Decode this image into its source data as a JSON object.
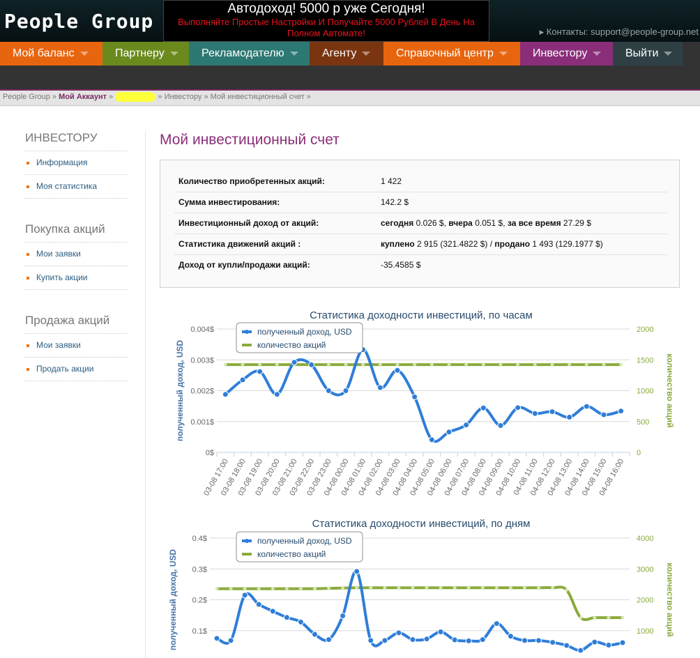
{
  "header": {
    "logo": "People Group",
    "promo_title": "Автодоход! 5000 р уже Сегодня!",
    "promo_text": "Выполняйте Простые Настройки И Получайте 5000 Рублей В День На Полном Автомате!",
    "contacts": "▸ Контакты: support@people-group.net"
  },
  "nav": [
    {
      "label": "Мой баланс",
      "color": "#e8650f"
    },
    {
      "label": "Партнеру",
      "color": "#6b8a1d"
    },
    {
      "label": "Рекламодателю",
      "color": "#2c7872"
    },
    {
      "label": "Агенту",
      "color": "#7a3510"
    },
    {
      "label": "Справочный центр",
      "color": "#e8650f"
    },
    {
      "label": "Инвестору",
      "color": "#8b2e79"
    },
    {
      "label": "Выйти",
      "color": "#2f4045"
    }
  ],
  "breadcrumb": {
    "home": "People Group",
    "sep": "»",
    "account": "Мой Аккаунт",
    "investor": "Инвестору",
    "current": "Мой инвестиционный счет"
  },
  "sidebar": {
    "sections": [
      {
        "title": "ИНВЕСТОРУ",
        "items": [
          "Информация",
          "Моя статистика"
        ]
      },
      {
        "title": "Покупка акций",
        "items": [
          "Мои заявки",
          "Купить акции"
        ]
      },
      {
        "title": "Продажа акций",
        "items": [
          "Мои заявки",
          "Продать акции"
        ]
      }
    ]
  },
  "main": {
    "title": "Мой инвестиционный счет",
    "rows": [
      {
        "key": "Количество приобретенных акций:",
        "value": "1 422"
      },
      {
        "key": "Сумма инвестирования:",
        "value": "142.2 $"
      },
      {
        "key": "Инвестиционный доход от акций:",
        "parts": [
          [
            "сегодня",
            " 0.026 $, "
          ],
          [
            "вчера",
            " 0.051 $, "
          ],
          [
            "за все время",
            " 27.29 $"
          ]
        ]
      },
      {
        "key": "Статистика движений акций :",
        "parts": [
          [
            "куплено",
            " 2 915 (321.4822 $) / "
          ],
          [
            "продано",
            " 1 493 (129.1977 $)"
          ]
        ]
      },
      {
        "key": "Доход от купли/продажи акций:",
        "value": "-35.4585 $"
      }
    ]
  },
  "chart_data": [
    {
      "type": "line",
      "title": "Статистика доходности инвестиций, по часам",
      "ylabel": "полученный доход, USD",
      "y2label": "количество акций",
      "legend_position": "top-left",
      "grid": true,
      "categories": [
        "03-08 17:00",
        "03-08 18:00",
        "03-08 19:00",
        "03-08 20:00",
        "03-08 21:00",
        "03-08 22:00",
        "03-08 23:00",
        "04-08 00:00",
        "04-08 01:00",
        "04-08 02:00",
        "04-08 03:00",
        "04-08 04:00",
        "04-08 05:00",
        "04-08 06:00",
        "04-08 07:00",
        "04-08 08:00",
        "04-08 09:00",
        "04-08 10:00",
        "04-08 11:00",
        "04-08 12:00",
        "04-08 13:00",
        "04-08 14:00",
        "04-08 15:00",
        "04-08 16:00"
      ],
      "ylim": [
        0,
        0.004
      ],
      "yticks": [
        "0$",
        "0.001$",
        "0.002$",
        "0.003$",
        "0.004$"
      ],
      "y2lim": [
        0,
        2000
      ],
      "y2ticks": [
        "0",
        "500",
        "1000",
        "1500",
        "2000"
      ],
      "series": [
        {
          "name": "полученный доход, USD",
          "axis": "left",
          "color": "#2f7ed8",
          "values": [
            0.00188,
            0.00235,
            0.00262,
            0.00188,
            0.00292,
            0.00284,
            0.002,
            0.002,
            0.00333,
            0.0021,
            0.00266,
            0.0018,
            0.00041,
            0.00066,
            0.00089,
            0.00144,
            0.00087,
            0.00145,
            0.00126,
            0.00132,
            0.00114,
            0.00149,
            0.00122,
            0.00134
          ]
        },
        {
          "name": "количество акций",
          "axis": "right",
          "color": "#8bab3c",
          "values": [
            1422,
            1422,
            1422,
            1422,
            1422,
            1422,
            1422,
            1422,
            1422,
            1422,
            1422,
            1422,
            1422,
            1422,
            1422,
            1422,
            1422,
            1422,
            1422,
            1422,
            1422,
            1422,
            1422,
            1422
          ]
        }
      ]
    },
    {
      "type": "line",
      "title": "Статистика доходности инвестиций, по дням",
      "ylabel": "полученный доход, USD",
      "y2label": "количество акций",
      "legend_position": "top-left",
      "grid": true,
      "ylim": [
        0,
        0.4
      ],
      "yticks": [
        "0.1$",
        "0.2$",
        "0.3$",
        "0.4$"
      ],
      "y2lim": [
        0,
        4000
      ],
      "y2ticks": [
        "1000",
        "2000",
        "3000",
        "4000"
      ],
      "series": [
        {
          "name": "полученный доход, USD",
          "axis": "left",
          "color": "#2f7ed8",
          "values": [
            0.075,
            0.068,
            0.215,
            0.185,
            0.163,
            0.143,
            0.128,
            0.088,
            0.071,
            0.148,
            0.292,
            0.068,
            0.068,
            0.093,
            0.071,
            0.073,
            0.096,
            0.07,
            0.067,
            0.071,
            0.123,
            0.082,
            0.068,
            0.068,
            0.062,
            0.052,
            0.036,
            0.063,
            0.053,
            0.061
          ]
        },
        {
          "name": "количество акций",
          "axis": "right",
          "color": "#8bab3c",
          "values": [
            2360,
            2360,
            2360,
            2360,
            2360,
            2360,
            2360,
            2360,
            2370,
            2380,
            2390,
            2390,
            2390,
            2390,
            2390,
            2390,
            2390,
            2390,
            2390,
            2390,
            2390,
            2390,
            2390,
            2390,
            2390,
            2320,
            1422,
            1422,
            1422,
            1422
          ]
        }
      ]
    }
  ]
}
